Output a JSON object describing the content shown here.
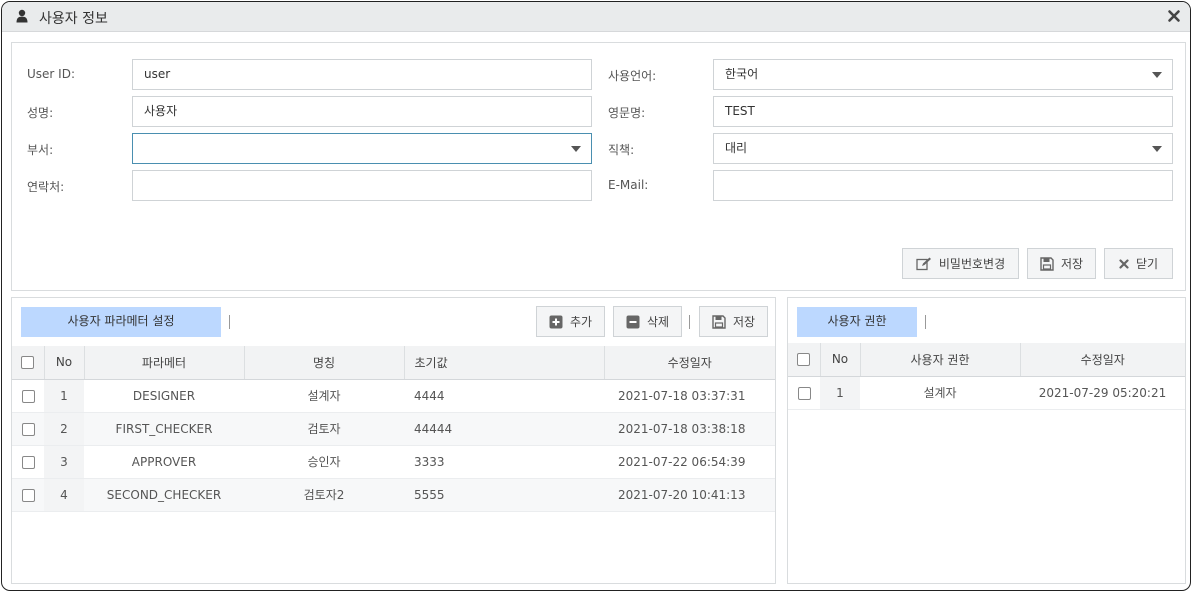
{
  "window": {
    "title": "사용자 정보",
    "title_icon": "user-icon",
    "close_icon": "close-icon"
  },
  "form": {
    "user_id": {
      "label": "User ID:",
      "value": "user"
    },
    "name": {
      "label": "성명:",
      "value": "사용자"
    },
    "dept": {
      "label": "부서:",
      "value": ""
    },
    "contact": {
      "label": "연락처:",
      "value": ""
    },
    "language": {
      "label": "사용언어:",
      "value": "한국어"
    },
    "eng_name": {
      "label": "영문명:",
      "value": "TEST"
    },
    "position": {
      "label": "직책:",
      "value": "대리"
    },
    "email": {
      "label": "E-Mail:",
      "value": ""
    }
  },
  "form_buttons": {
    "change_password": "비밀번호변경",
    "save": "저장",
    "close": "닫기"
  },
  "params": {
    "tab_title": "사용자 파라메터 설정",
    "buttons": {
      "add": "추가",
      "delete": "삭제",
      "save": "저장"
    },
    "columns": [
      "No",
      "파라메터",
      "명칭",
      "초기값",
      "수정일자"
    ],
    "rows": [
      {
        "no": "1",
        "param": "DESIGNER",
        "name": "설계자",
        "init": "4444",
        "date": "2021-07-18 03:37:31"
      },
      {
        "no": "2",
        "param": "FIRST_CHECKER",
        "name": "검토자",
        "init": "44444",
        "date": "2021-07-18 03:38:18"
      },
      {
        "no": "3",
        "param": "APPROVER",
        "name": "승인자",
        "init": "3333",
        "date": "2021-07-22 06:54:39"
      },
      {
        "no": "4",
        "param": "SECOND_CHECKER",
        "name": "검토자2",
        "init": "5555",
        "date": "2021-07-20 10:41:13"
      }
    ]
  },
  "auth": {
    "tab_title": "사용자 권한",
    "columns": [
      "No",
      "사용자 권한",
      "수정일자"
    ],
    "rows": [
      {
        "no": "1",
        "auth": "설계자",
        "date": "2021-07-29 05:20:21"
      }
    ]
  },
  "colors": {
    "tab_bg": "#bcd8ff",
    "focus_border": "#4a8fb0"
  }
}
